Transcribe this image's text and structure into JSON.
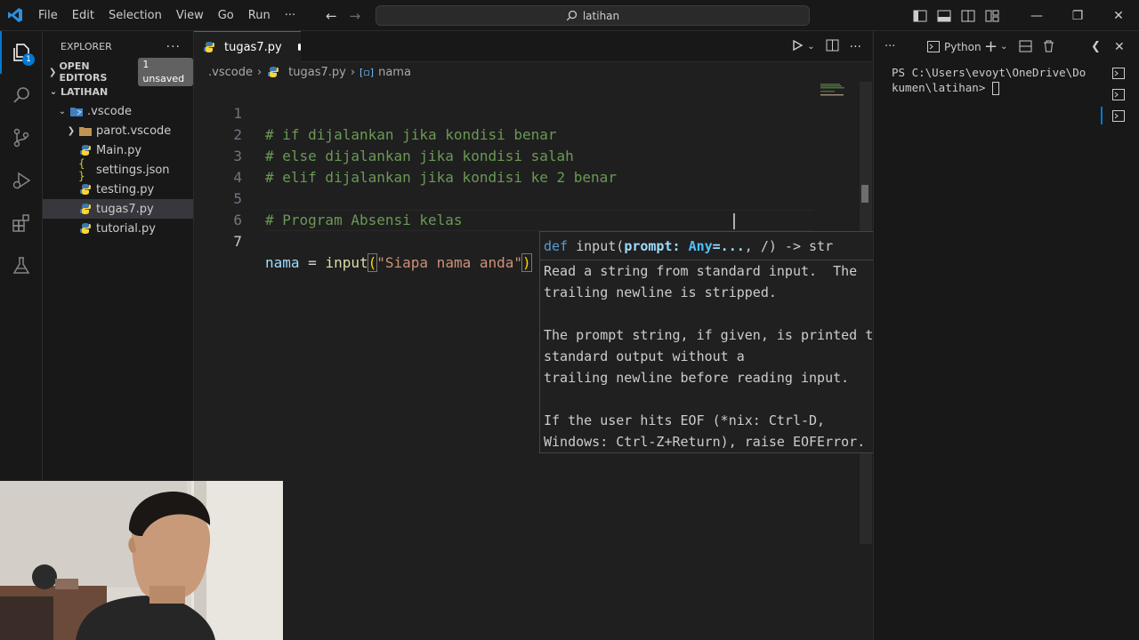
{
  "titlebar": {
    "menus": [
      "File",
      "Edit",
      "Selection",
      "View",
      "Go",
      "Run",
      "···"
    ],
    "search_text": "latihan"
  },
  "activity": {
    "explorer_badge": "1"
  },
  "sidebar": {
    "title": "EXPLORER",
    "open_editors_label": "OPEN EDITORS",
    "unsaved_badge": "1 unsaved",
    "folder_label": "LATIHAN",
    "tree": [
      {
        "label": ".vscode",
        "kind": "folder-open"
      },
      {
        "label": "parot.vscode",
        "kind": "folder"
      },
      {
        "label": "Main.py",
        "kind": "python"
      },
      {
        "label": "settings.json",
        "kind": "json"
      },
      {
        "label": "testing.py",
        "kind": "python"
      },
      {
        "label": "tugas7.py",
        "kind": "python",
        "selected": true
      },
      {
        "label": "tutorial.py",
        "kind": "python"
      }
    ]
  },
  "editor": {
    "tab_label": "tugas7.py",
    "breadcrumb": [
      ".vscode",
      "tugas7.py",
      "nama"
    ],
    "lines": [
      {
        "n": "1",
        "text": "# if dijalankan jika kondisi benar"
      },
      {
        "n": "2",
        "text": "# else dijalankan jika kondisi salah"
      },
      {
        "n": "3",
        "text": "# elif dijalankan jika kondisi ke 2 benar"
      },
      {
        "n": "4",
        "text": ""
      },
      {
        "n": "5",
        "text": "# Program Absensi kelas"
      },
      {
        "n": "6",
        "text": ""
      },
      {
        "n": "7",
        "text": ""
      }
    ],
    "line7": {
      "var": "nama",
      "op": " = ",
      "fn": "input",
      "open": "(",
      "str": "\"Siapa nama anda\"",
      "close": ")"
    }
  },
  "hover": {
    "sig_def": "def ",
    "sig_fn": "input(",
    "sig_param": "prompt",
    "sig_colon": ": ",
    "sig_type": "Any",
    "sig_default": "=...",
    "sig_rest": ", /) -> str",
    "doc": "Read a string from standard input.  The\ntrailing newline is stripped.\n\nThe prompt string, if given, is printed to\nstandard output without a\ntrailing newline before reading input.\n\nIf the user hits EOF (*nix: Ctrl-D,\nWindows: Ctrl-Z+Return), raise EOFError."
  },
  "terminal": {
    "profile_label": "Python",
    "output": "PS C:\\Users\\evoyt\\OneDrive\\Do\nkumen\\latihan> "
  },
  "colors": {
    "accent": "#0078d4",
    "comment": "#6a9955",
    "string": "#ce9178",
    "function": "#dcdcaa",
    "variable": "#9cdcfe"
  }
}
